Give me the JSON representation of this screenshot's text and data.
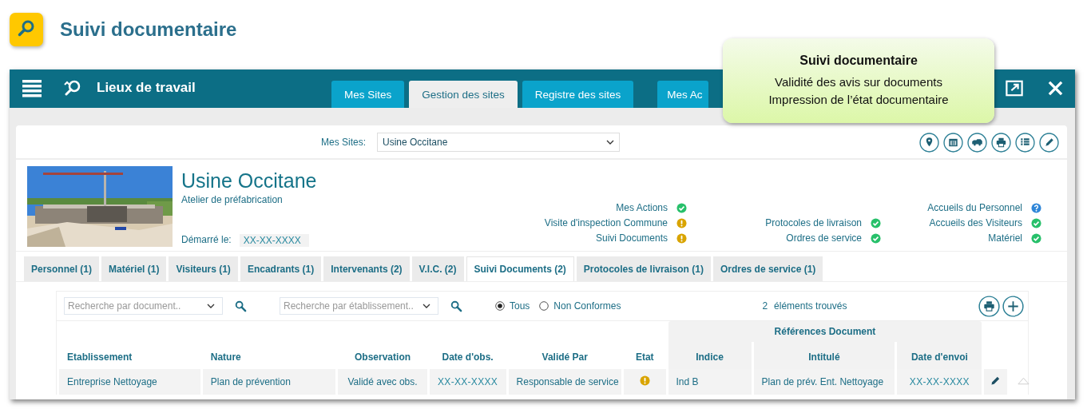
{
  "header": {
    "title": "Suivi documentaire"
  },
  "window": {
    "title": "Lieux de travail",
    "tabs": [
      {
        "label": "Mes Sites",
        "selected": false
      },
      {
        "label": "Gestion des sites",
        "selected": true
      },
      {
        "label": "Registre des sites",
        "selected": false
      },
      {
        "label": "Mes Ac",
        "selected": false
      }
    ]
  },
  "tooltip": {
    "title": "Suivi documentaire",
    "lines": [
      "Validité des avis sur documents",
      "Impression de l’état documentaire"
    ]
  },
  "site_selector": {
    "label": "Mes Sites:",
    "value": "Usine Occitane"
  },
  "site": {
    "name": "Usine Occitane",
    "subtitle": "Atelier de préfabrication",
    "started_label": "Démarré le:",
    "started_value": "XX-XX-XXXX"
  },
  "statuses": [
    [
      {
        "label": "Mes Actions",
        "kind": "ok"
      },
      {
        "label": "Visite d'inspection Commune",
        "kind": "warning"
      },
      {
        "label": "Suivi Documents",
        "kind": "warning"
      }
    ],
    [
      {
        "label": "Protocoles de livraison",
        "kind": "ok"
      },
      {
        "label": "Ordres de service",
        "kind": "ok"
      }
    ],
    [
      {
        "label": "Accueils du Personnel",
        "kind": "info"
      },
      {
        "label": "Accueils des Visiteurs",
        "kind": "ok"
      },
      {
        "label": "Matériel",
        "kind": "ok"
      }
    ]
  ],
  "section_tabs": [
    {
      "label": "Personnel (1)",
      "selected": false
    },
    {
      "label": "Matériel (1)",
      "selected": false
    },
    {
      "label": "Visiteurs (1)",
      "selected": false
    },
    {
      "label": "Encadrants (1)",
      "selected": false
    },
    {
      "label": "Intervenants (2)",
      "selected": false
    },
    {
      "label": "V.I.C. (2)",
      "selected": false
    },
    {
      "label": "Suivi Documents (2)",
      "selected": true
    },
    {
      "label": "Protocoles de livraison (1)",
      "selected": false
    },
    {
      "label": "Ordres de service (1)",
      "selected": false
    }
  ],
  "filters": {
    "document_search": {
      "placeholder": "Recherche par document.."
    },
    "establishment_search": {
      "placeholder": "Recherche par établissement.."
    },
    "radios": [
      {
        "label": "Tous",
        "selected": true
      },
      {
        "label": "Non Conformes",
        "selected": false
      }
    ],
    "count": "2",
    "count_label": "éléments trouvés"
  },
  "table": {
    "group_header": "Références Document",
    "columns": [
      "Etablissement",
      "Nature",
      "Observation",
      "Date d'obs.",
      "Validé Par",
      "Etat",
      "Indice",
      "Intitulé",
      "Date d'envoi"
    ],
    "rows": [
      {
        "etablissement": "Entreprise Nettoyage",
        "nature": "Plan de prévention",
        "observation": "Validé avec obs.",
        "date_obs": "XX-XX-XXXX",
        "valide_par": "Responsable de service",
        "etat": {
          "kind": "warning"
        },
        "indice": "Ind B",
        "intitule": "Plan de prév. Ent. Nettoyage",
        "date_envoi": "XX-XX-XXXX"
      }
    ]
  }
}
